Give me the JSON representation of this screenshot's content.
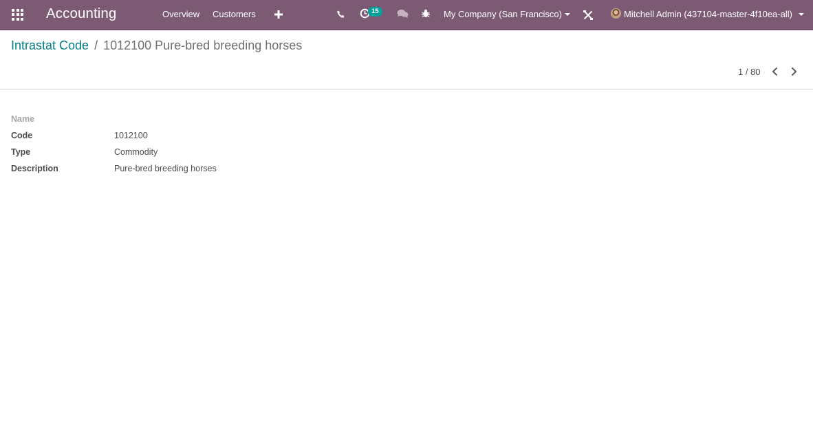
{
  "colors": {
    "brand": "#7c5a74",
    "accent": "#00a09d",
    "link": "#017e84"
  },
  "navbar": {
    "app_title": "Accounting",
    "menu": [
      {
        "label": "Overview"
      },
      {
        "label": "Customers"
      }
    ],
    "icons": [
      "apps-icon",
      "plus-icon",
      "phone-icon",
      "activity-clock-icon",
      "chat-icon",
      "bug-icon",
      "tools-icon"
    ],
    "activity_badge": "15",
    "company": "My Company (San Francisco)",
    "user": "Mitchell Admin (437104-master-4f10ea-all)"
  },
  "breadcrumb": {
    "parent": "Intrastat Code",
    "separator": "/",
    "current": "1012100 Pure-bred breeding horses"
  },
  "pager": {
    "value": "1 / 80"
  },
  "form": {
    "fields": [
      {
        "label": "Name",
        "value": ""
      },
      {
        "label": "Code",
        "value": "1012100"
      },
      {
        "label": "Type",
        "value": "Commodity"
      },
      {
        "label": "Description",
        "value": "Pure-bred breeding horses"
      }
    ]
  }
}
